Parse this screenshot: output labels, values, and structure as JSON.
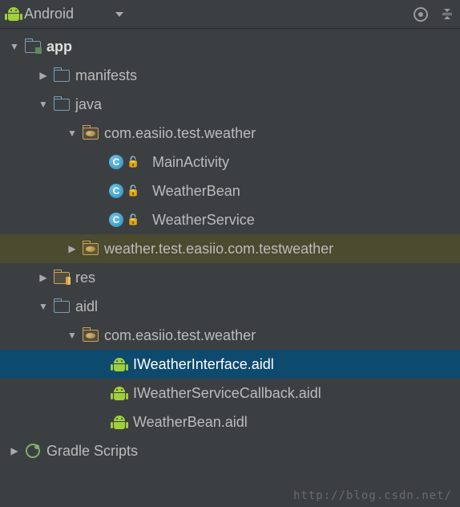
{
  "header": {
    "title": "Android"
  },
  "tree": {
    "app": "app",
    "manifests": "manifests",
    "java": "java",
    "pkg1": "com.easiio.test.weather",
    "mainActivity": "MainActivity",
    "weatherBean": "WeatherBean",
    "weatherService": "WeatherService",
    "pkg2": "weather.test.easiio.com.testweather",
    "res": "res",
    "aidl": "aidl",
    "pkg3": "com.easiio.test.weather",
    "iWeatherInterface": "IWeatherInterface.aidl",
    "iWeatherServiceCallback": "IWeatherServiceCallback.aidl",
    "weatherBeanAidl": "WeatherBean.aidl",
    "gradle": "Gradle Scripts"
  },
  "watermark": "http://blog.csdn.net/"
}
